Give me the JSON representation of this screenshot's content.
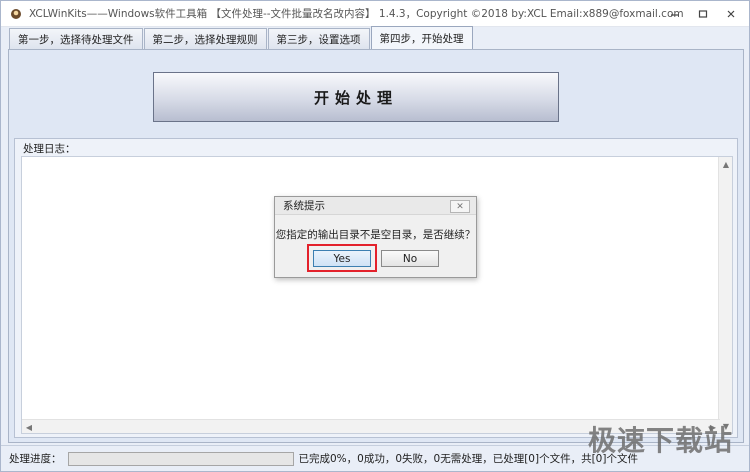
{
  "window": {
    "title": "XCLWinKits——Windows软件工具箱 【文件处理--文件批量改名改内容】 1.4.3，Copyright ©2018 by:XCL Email:x889@foxmail.com",
    "icons": {
      "app": "app-logo-icon",
      "minimize": "minimize-icon",
      "maximize": "maximize-icon",
      "close": "close-icon"
    }
  },
  "tabs": [
    {
      "label": "第一步，选择待处理文件"
    },
    {
      "label": "第二步，选择处理规则"
    },
    {
      "label": "第三步，设置选项"
    },
    {
      "label": "第四步，开始处理",
      "active": true
    }
  ],
  "main": {
    "start_button": "开始处理",
    "log_label": "处理日志："
  },
  "dialog": {
    "title": "系统提示",
    "message": "您指定的输出目录不是空目录，是否继续？",
    "yes": "Yes",
    "no": "No"
  },
  "status": {
    "label": "处理进度：",
    "progress_percent": 0,
    "text": "已完成0%，0成功，0失败，0无需处理，已处理[0]个文件，共[0]个文件"
  },
  "watermark": "极速下载站",
  "colors": {
    "highlight": "#e3212b",
    "progress_fill": "#3cb043",
    "panel": "#dfe7f4"
  }
}
